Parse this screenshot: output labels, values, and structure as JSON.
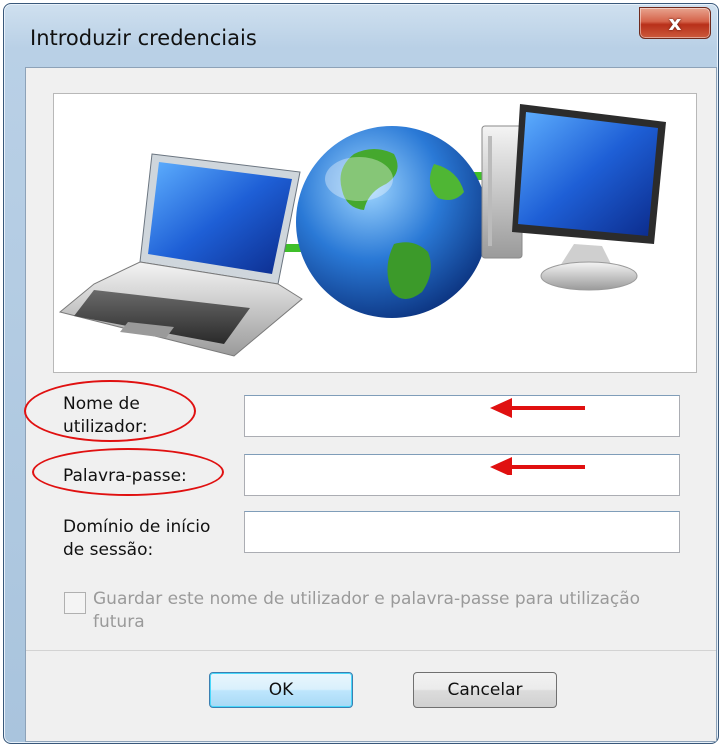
{
  "window": {
    "title": "Introduzir credenciais",
    "close_glyph": "x"
  },
  "fields": {
    "username": {
      "label": "Nome de\nutilizador:",
      "value": ""
    },
    "password": {
      "label": "Palavra-passe:",
      "value": ""
    },
    "domain": {
      "label": "Domínio de início\nde sessão:",
      "value": ""
    }
  },
  "remember": {
    "label": "Guardar este nome de utilizador e palavra-passe para utilização futura",
    "checked": false
  },
  "buttons": {
    "ok": "OK",
    "cancel": "Cancelar"
  },
  "annotations": {
    "color": "#e01010"
  },
  "illustration": {
    "icons": [
      "laptop-icon",
      "globe-icon",
      "desktop-computer-icon"
    ]
  }
}
